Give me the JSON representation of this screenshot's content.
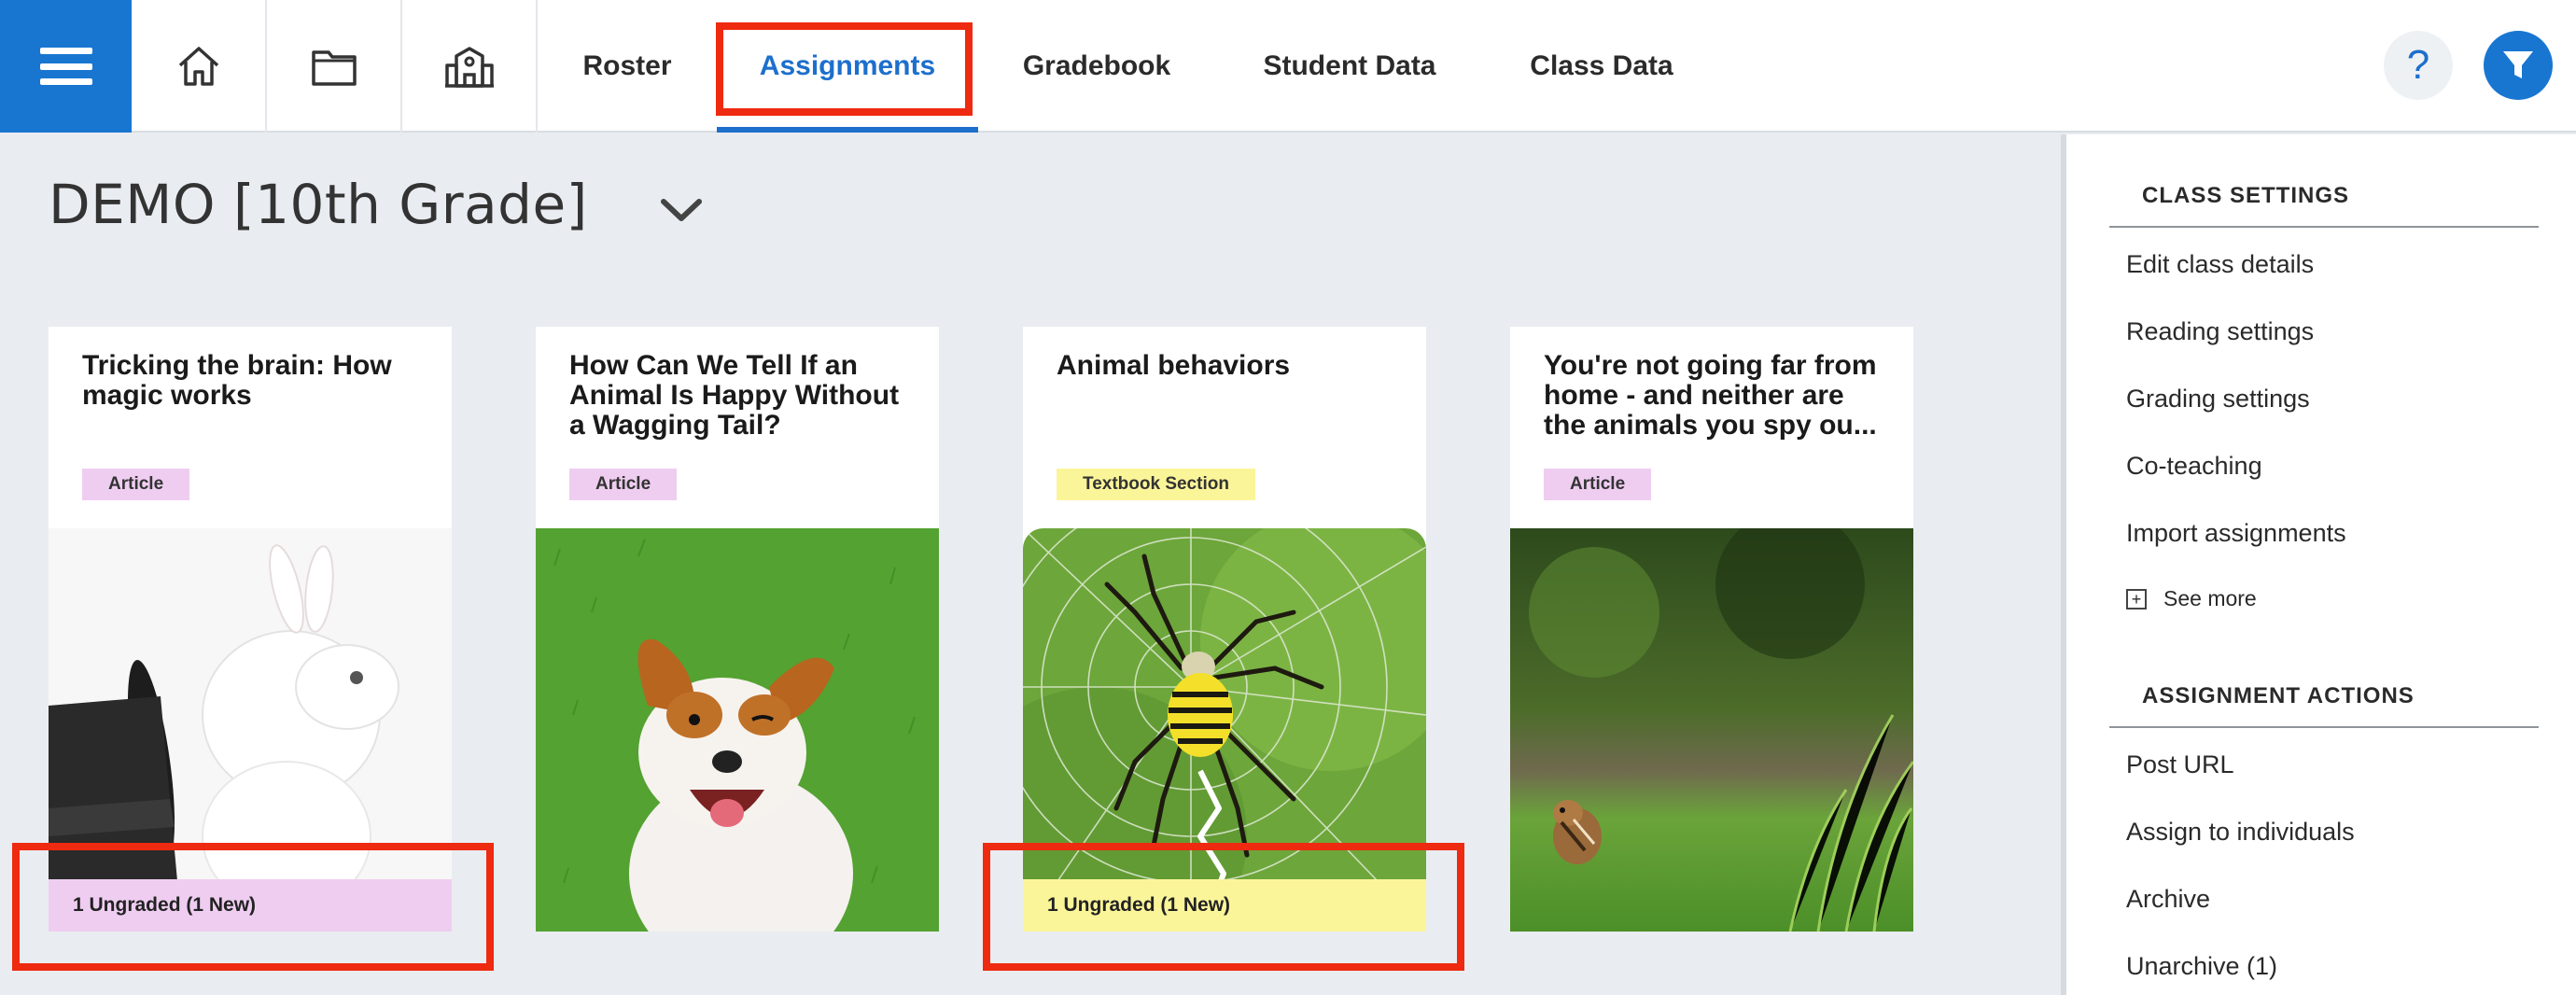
{
  "nav": {
    "tabs": [
      {
        "label": "Roster"
      },
      {
        "label": "Assignments"
      },
      {
        "label": "Gradebook"
      },
      {
        "label": "Student Data"
      },
      {
        "label": "Class Data"
      }
    ],
    "active_tab": "Assignments",
    "help_label": "?",
    "icons": [
      "menu-icon",
      "home-icon",
      "folder-icon",
      "school-icon",
      "help-icon",
      "filter-icon"
    ]
  },
  "class_selector": {
    "title": "DEMO [10th Grade]",
    "icon": "chevron-down-icon"
  },
  "assignments": [
    {
      "title": "Tricking the brain: How magic works",
      "type": "Article",
      "status": "1 Ungraded (1 New)",
      "image": "rabbit-in-top-hat"
    },
    {
      "title": "How Can We Tell If an Animal Is Happy Without a Wagging Tail?",
      "type": "Article",
      "status": "",
      "image": "happy-dog-on-grass"
    },
    {
      "title": "Animal behaviors",
      "type": "Textbook Section",
      "status": "1 Ungraded (1 New)",
      "image": "spider-on-web"
    },
    {
      "title": "You're not going far from home - and neither are the animals you spy ou...",
      "type": "Article",
      "status": "",
      "image": "chipmunk-in-grass"
    }
  ],
  "sidebar": {
    "class_settings": {
      "heading": "CLASS SETTINGS",
      "links": [
        "Edit class details",
        "Reading settings",
        "Grading settings",
        "Co-teaching",
        "Import assignments"
      ],
      "see_more": "See more"
    },
    "assignment_actions": {
      "heading": "ASSIGNMENT ACTIONS",
      "links": [
        "Post URL",
        "Assign to individuals",
        "Archive",
        "Unarchive (1)"
      ]
    }
  },
  "colors": {
    "brand_blue": "#1876d1",
    "active_tab": "#1d6fcc",
    "article_badge": "#efcdf1",
    "textbook_badge": "#fbf59a",
    "highlight_red": "#ee2a10"
  }
}
